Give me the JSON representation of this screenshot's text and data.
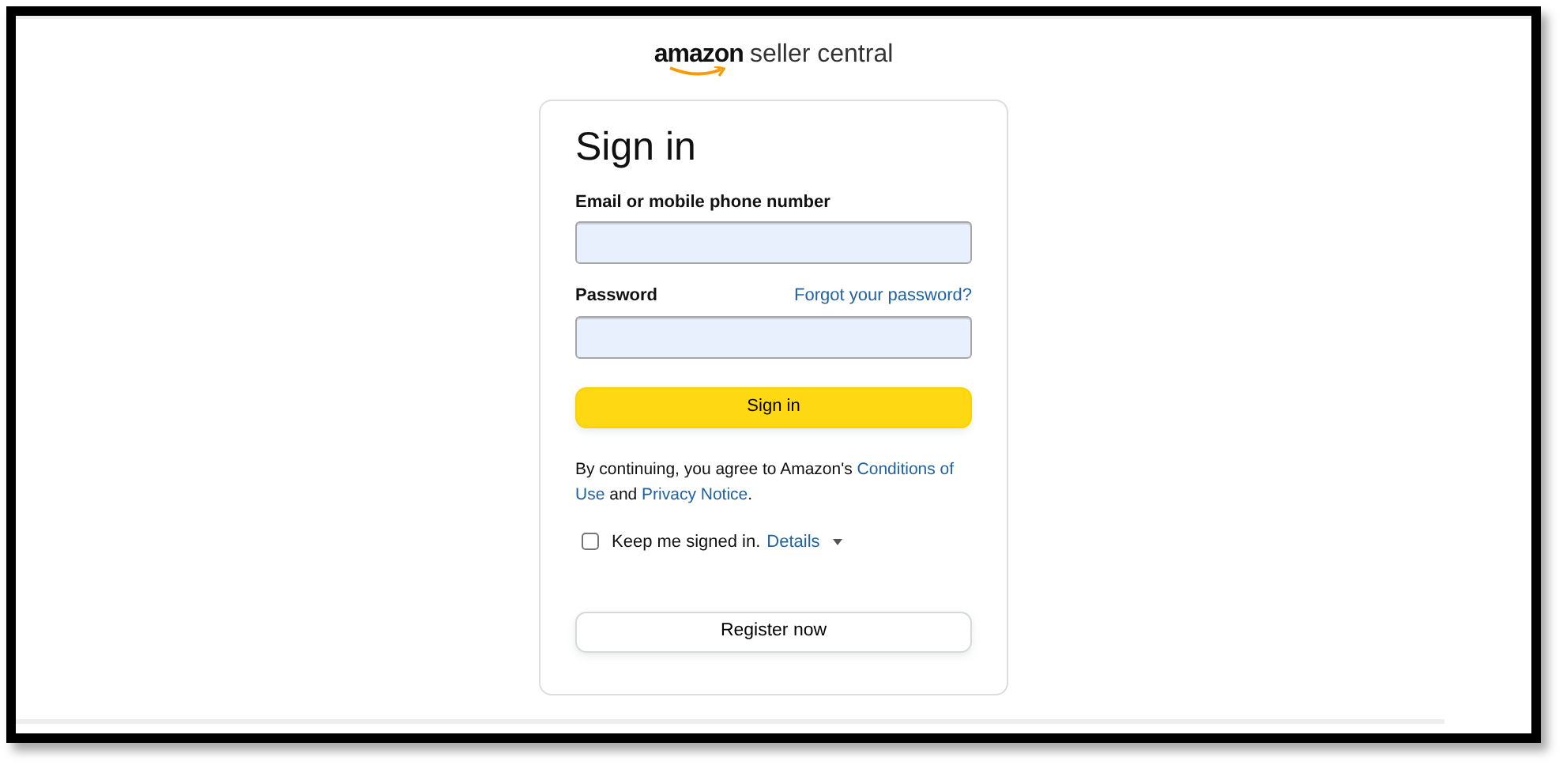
{
  "logo": {
    "brand": "amazon",
    "product": "seller central"
  },
  "form": {
    "title": "Sign in",
    "email": {
      "label": "Email or mobile phone number"
    },
    "password": {
      "label": "Password",
      "forgot_link": "Forgot your password?"
    },
    "submit": "Sign in",
    "legal": {
      "text": "By continuing, you agree to Amazon's ",
      "link1_lines": [
        "Conditions of",
        "Use"
      ],
      "middle": " and ",
      "link2": "Privacy Notice",
      "end": "."
    },
    "keep_signed_in": {
      "label": "Keep me signed in.",
      "checked": false,
      "details_link": "Details"
    },
    "register": "Register now"
  }
}
